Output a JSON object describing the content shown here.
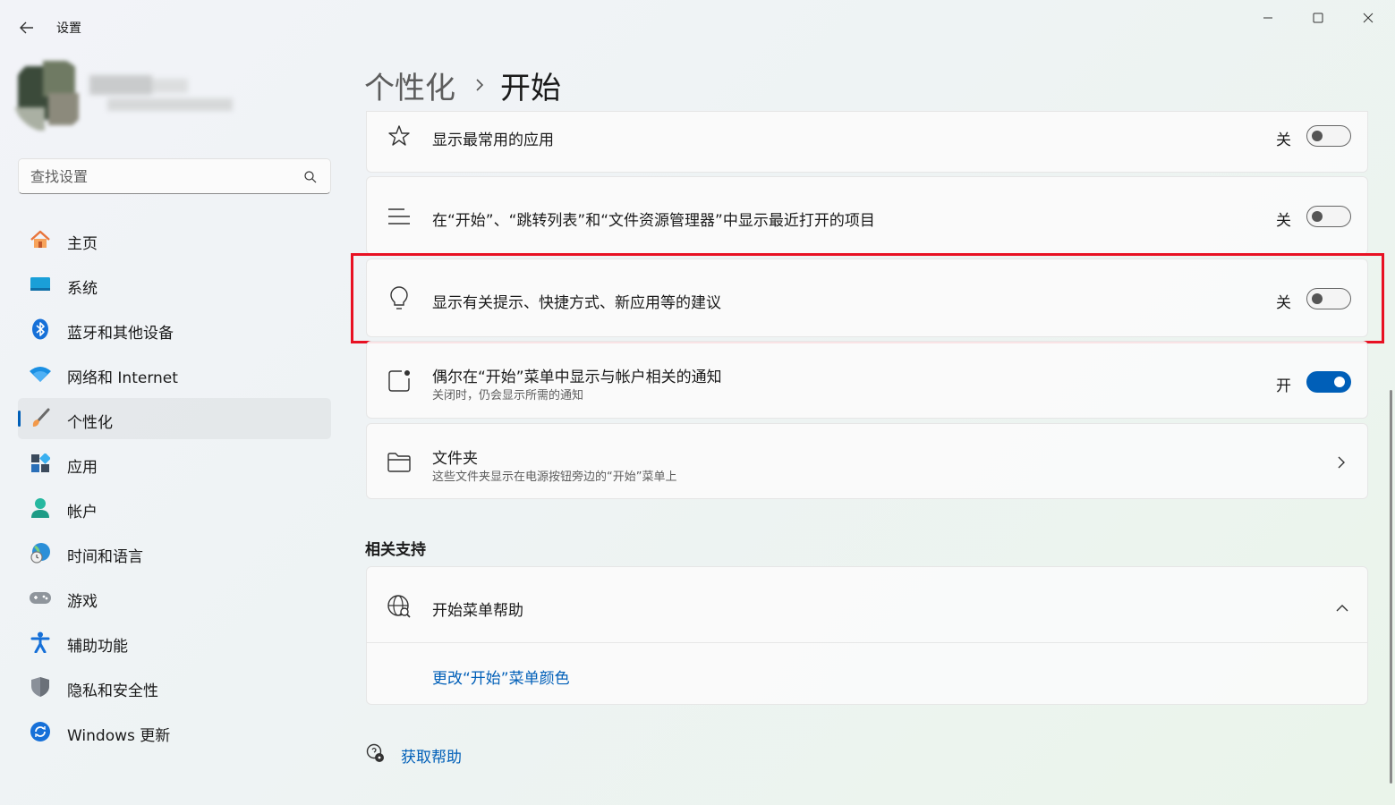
{
  "window": {
    "title": "设置",
    "controls": {
      "minimize": "minimize-icon",
      "maximize": "maximize-icon",
      "close": "close-icon"
    }
  },
  "search": {
    "placeholder": "查找设置"
  },
  "sidebar": {
    "items": [
      {
        "label": "主页",
        "icon": "home-icon",
        "active": false
      },
      {
        "label": "系统",
        "icon": "system-icon",
        "active": false
      },
      {
        "label": "蓝牙和其他设备",
        "icon": "bluetooth-icon",
        "active": false
      },
      {
        "label": "网络和 Internet",
        "icon": "wifi-icon",
        "active": false
      },
      {
        "label": "个性化",
        "icon": "brush-icon",
        "active": true
      },
      {
        "label": "应用",
        "icon": "apps-icon",
        "active": false
      },
      {
        "label": "帐户",
        "icon": "account-icon",
        "active": false
      },
      {
        "label": "时间和语言",
        "icon": "time-language-icon",
        "active": false
      },
      {
        "label": "游戏",
        "icon": "gamepad-icon",
        "active": false
      },
      {
        "label": "辅助功能",
        "icon": "accessibility-icon",
        "active": false
      },
      {
        "label": "隐私和安全性",
        "icon": "shield-icon",
        "active": false
      },
      {
        "label": "Windows 更新",
        "icon": "update-icon",
        "active": false
      }
    ]
  },
  "breadcrumb": {
    "parent": "个性化",
    "current": "开始"
  },
  "settings": {
    "most_used": {
      "title": "显示最常用的应用",
      "state": "关",
      "on": false,
      "icon": "star-icon"
    },
    "recent_items": {
      "title": "在“开始”、“跳转列表”和“文件资源管理器”中显示最近打开的项目",
      "state": "关",
      "on": false,
      "icon": "list-icon"
    },
    "suggestions": {
      "title": "显示有关提示、快捷方式、新应用等的建议",
      "state": "关",
      "on": false,
      "icon": "lightbulb-icon"
    },
    "account_notifications": {
      "title": "偶尔在“开始”菜单中显示与帐户相关的通知",
      "subtitle": "关闭时，仍会显示所需的通知",
      "state": "开",
      "on": true,
      "icon": "notification-icon"
    },
    "folders": {
      "title": "文件夹",
      "subtitle": "这些文件夹显示在电源按钮旁边的“开始”菜单上",
      "icon": "folder-icon"
    }
  },
  "related_support": {
    "heading": "相关支持",
    "help_title": "开始菜单帮助",
    "link": "更改“开始”菜单颜色"
  },
  "get_help": "获取帮助",
  "colors": {
    "accent": "#005fb8",
    "highlight": "#e81123"
  }
}
